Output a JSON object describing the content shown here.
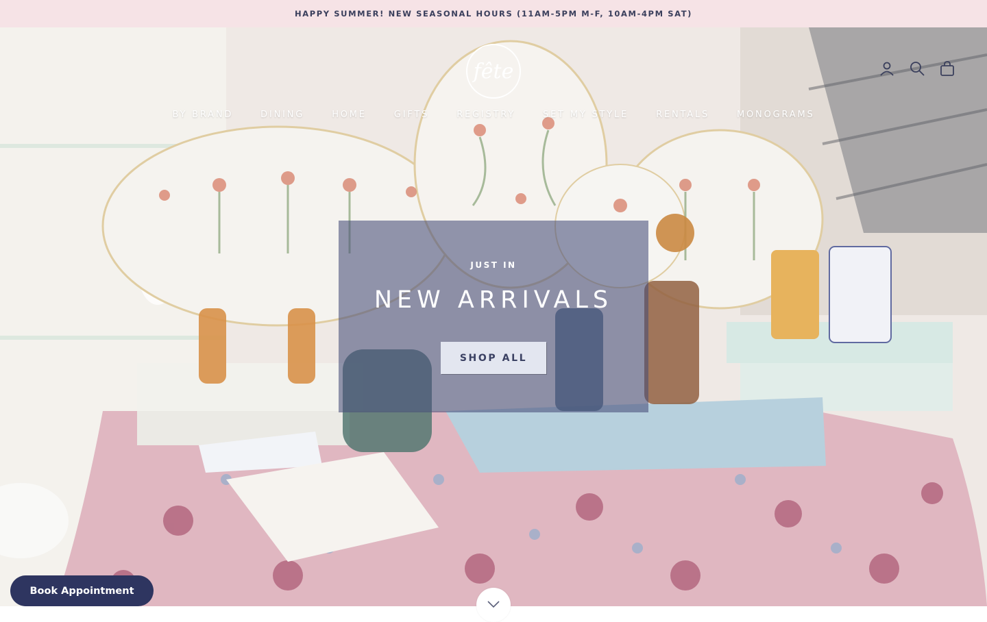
{
  "announcement": {
    "text": "HAPPY SUMMER! NEW SEASONAL HOURS (11AM-5PM M-F, 10AM-4PM SAT)"
  },
  "header": {
    "logo_text": "fête",
    "icons": [
      "account-icon",
      "search-icon",
      "cart-bag-icon"
    ]
  },
  "nav": {
    "items": [
      {
        "label": "BY BRAND"
      },
      {
        "label": "DINING"
      },
      {
        "label": "HOME"
      },
      {
        "label": "GIFTS"
      },
      {
        "label": "REGISTRY"
      },
      {
        "label": "SET MY STYLE"
      },
      {
        "label": "RENTALS"
      },
      {
        "label": "MONOGRAMS"
      }
    ]
  },
  "hero": {
    "eyebrow": "JUST IN",
    "title": "NEW ARRIVALS",
    "button_label": "SHOP ALL"
  },
  "floating": {
    "book_label": "Book Appointment"
  },
  "colors": {
    "announcement_bg": "#f6e3e6",
    "brand_navy": "#2e3560",
    "promo_overlay": "#464e78"
  }
}
